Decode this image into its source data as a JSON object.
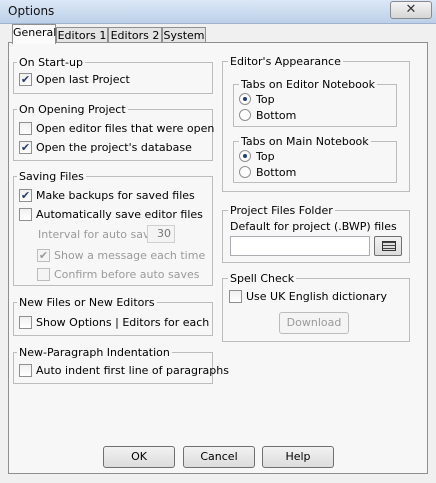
{
  "window": {
    "title": "Options",
    "close_glyph": "✕"
  },
  "tabs": [
    "General",
    "Editors 1",
    "Editors 2",
    "System"
  ],
  "startup": {
    "title": "On Start-up",
    "open_last_project": {
      "label": "Open last Project",
      "checked": true
    }
  },
  "opening": {
    "title": "On Opening Project",
    "open_editor_files": {
      "label": "Open editor files that were open",
      "checked": false
    },
    "open_database": {
      "label": "Open the project's database",
      "checked": true
    }
  },
  "saving": {
    "title": "Saving Files",
    "make_backups": {
      "label": "Make backups for saved files",
      "checked": true
    },
    "auto_save": {
      "label": "Automatically save editor files",
      "checked": false
    },
    "interval_label": "Interval for auto saves",
    "interval_value": "30",
    "show_message": {
      "label": "Show a message each time",
      "checked": true
    },
    "confirm": {
      "label": "Confirm before auto saves",
      "checked": false
    }
  },
  "newfiles": {
    "title": "New Files or New Editors",
    "show_options": {
      "label": "Show Options | Editors for each",
      "checked": false
    }
  },
  "indent": {
    "title": "New-Paragraph Indentation",
    "auto_indent": {
      "label": "Auto indent first line of paragraphs",
      "checked": false
    }
  },
  "appearance": {
    "title": "Editor's Appearance",
    "editor_tabs": {
      "title": "Tabs on Editor Notebook",
      "top": "Top",
      "bottom": "Bottom",
      "selected": "top"
    },
    "main_tabs": {
      "title": "Tabs on Main Notebook",
      "top": "Top",
      "bottom": "Bottom",
      "selected": "top"
    }
  },
  "project_folder": {
    "title": "Project Files Folder",
    "label": "Default for project (.BWP) files",
    "value": "",
    "browse_icon": "folder-browse-icon"
  },
  "spell": {
    "title": "Spell Check",
    "uk_dict": {
      "label": "Use UK English dictionary",
      "checked": false
    },
    "download_label": "Download"
  },
  "buttons": {
    "ok": "OK",
    "cancel": "Cancel",
    "help": "Help"
  },
  "check_glyph": "✔"
}
